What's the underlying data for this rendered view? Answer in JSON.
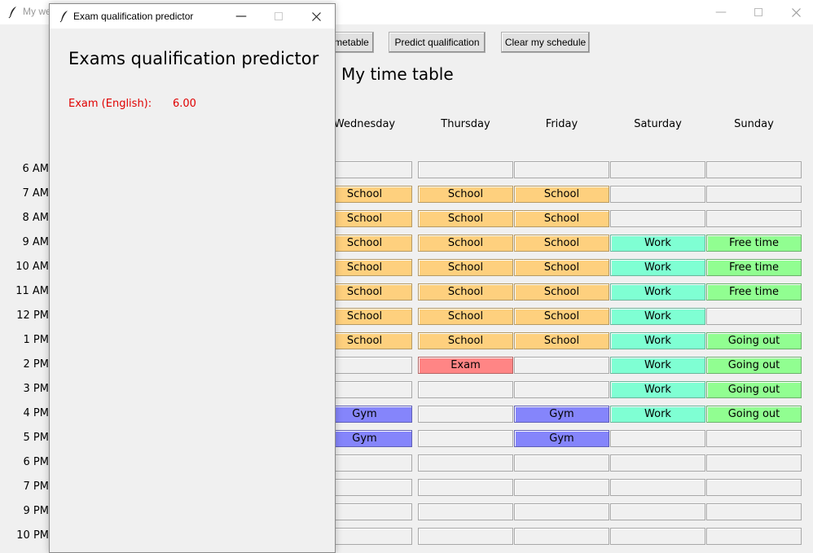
{
  "main_window": {
    "title": "My we",
    "buttons": {
      "timetable": "metable",
      "predict": "Predict qualification",
      "clear": "Clear my schedule"
    },
    "heading": "My time table",
    "days": [
      "Wednesday",
      "Thursday",
      "Friday",
      "Saturday",
      "Sunday"
    ],
    "hours": [
      "6 AM",
      "7 AM",
      "8 AM",
      "9 AM",
      "10 AM",
      "11 AM",
      "12 PM",
      "1 PM",
      "2 PM",
      "3 PM",
      "4 PM",
      "5 PM",
      "6 PM",
      "7 PM",
      "9 PM",
      "10 PM"
    ],
    "schedule": {
      "wednesday": [
        "",
        "School",
        "School",
        "School",
        "School",
        "School",
        "School",
        "School",
        "",
        "",
        "Gym",
        "Gym",
        "",
        "",
        "",
        ""
      ],
      "thursday": [
        "",
        "School",
        "School",
        "School",
        "School",
        "School",
        "School",
        "School",
        "Exam",
        "",
        "",
        "",
        "",
        "",
        "",
        ""
      ],
      "friday": [
        "",
        "School",
        "School",
        "School",
        "School",
        "School",
        "School",
        "School",
        "",
        "",
        "Gym",
        "Gym",
        "",
        "",
        "",
        ""
      ],
      "saturday": [
        "",
        "",
        "",
        "Work",
        "Work",
        "Work",
        "Work",
        "Work",
        "Work",
        "Work",
        "Work",
        "",
        "",
        "",
        "",
        ""
      ],
      "sunday": [
        "",
        "",
        "",
        "Free time",
        "Free time",
        "Free time",
        "",
        "Going out",
        "Going out",
        "Going out",
        "Going out",
        "",
        "",
        "",
        "",
        ""
      ]
    },
    "colors": {
      "School": "#fed07e",
      "Work": "#7fffd3",
      "Free time": "#91fe91",
      "Going out": "#91fe91",
      "Exam": "#ff8585",
      "Gym": "#8585fb"
    }
  },
  "dialog": {
    "title": "Exam qualification predictor",
    "heading": "Exams qualification predictor",
    "exam_label": "Exam (English):",
    "exam_value": "6.00"
  }
}
